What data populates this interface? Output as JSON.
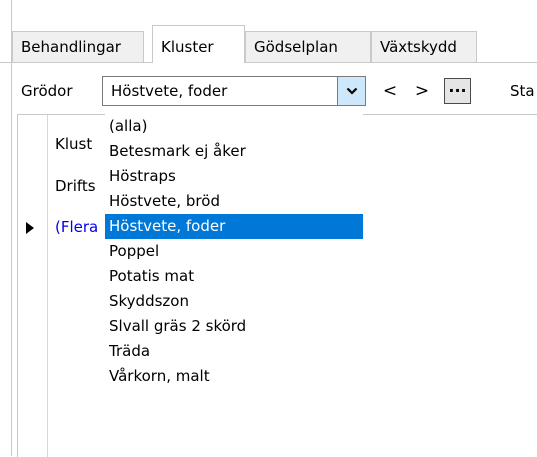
{
  "tabs": [
    {
      "label": "Behandlingar",
      "active": false
    },
    {
      "label": "Kluster",
      "active": true
    },
    {
      "label": "Gödselplan",
      "active": false
    },
    {
      "label": "Växtskydd",
      "active": false
    }
  ],
  "toolbar": {
    "grodor_label": "Grödor",
    "combo_value": "Höstvete, foder",
    "prev_label": "<",
    "next_label": ">",
    "more_label": "...",
    "status_label": "Sta"
  },
  "grid": {
    "rows": [
      "Klust",
      "Drifts",
      "(Flera"
    ]
  },
  "dropdown": {
    "items": [
      "(alla)",
      "Betesmark ej åker",
      "Höstraps",
      "Höstvete, bröd",
      "Höstvete, foder",
      "Poppel",
      "Potatis mat",
      "Skyddszon",
      "Slvall gräs 2 skörd",
      "Träda",
      "Vårkorn, malt"
    ],
    "selected_index": 4
  },
  "colors": {
    "selection": "#0078d7",
    "link_blue": "#0000ee",
    "combo_arrow_bg": "#cde8fb"
  }
}
